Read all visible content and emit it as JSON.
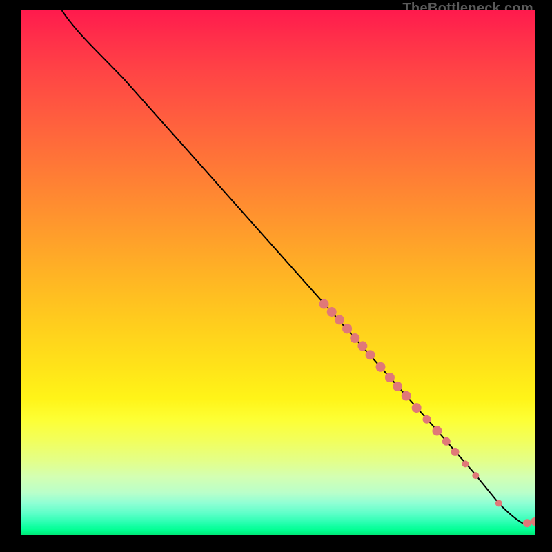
{
  "watermark": "TheBottleneck.com",
  "chart_data": {
    "type": "line",
    "title": "",
    "xlabel": "",
    "ylabel": "",
    "xlim": [
      0,
      100
    ],
    "ylim": [
      0,
      100
    ],
    "background_gradient": {
      "top": "#ff1a4d",
      "middle": "#ffe319",
      "bottom": "#00e878"
    },
    "curve": {
      "description": "Descending bottleneck curve from top-left to bottom-right",
      "points": [
        {
          "x": 8,
          "y": 100
        },
        {
          "x": 10,
          "y": 97
        },
        {
          "x": 14,
          "y": 93
        },
        {
          "x": 20,
          "y": 87
        },
        {
          "x": 30,
          "y": 76
        },
        {
          "x": 40,
          "y": 65
        },
        {
          "x": 50,
          "y": 54
        },
        {
          "x": 60,
          "y": 43
        },
        {
          "x": 70,
          "y": 32
        },
        {
          "x": 80,
          "y": 21
        },
        {
          "x": 88,
          "y": 12
        },
        {
          "x": 93,
          "y": 6
        },
        {
          "x": 96,
          "y": 3
        },
        {
          "x": 98,
          "y": 2
        },
        {
          "x": 100,
          "y": 2.5
        }
      ]
    },
    "highlighted_points": [
      {
        "x": 59,
        "y": 44,
        "r": 7
      },
      {
        "x": 60.5,
        "y": 42.5,
        "r": 7
      },
      {
        "x": 62,
        "y": 41,
        "r": 7
      },
      {
        "x": 63.5,
        "y": 39.3,
        "r": 7
      },
      {
        "x": 65,
        "y": 37.5,
        "r": 7
      },
      {
        "x": 66.5,
        "y": 36,
        "r": 7
      },
      {
        "x": 68,
        "y": 34.3,
        "r": 7
      },
      {
        "x": 70,
        "y": 32,
        "r": 7
      },
      {
        "x": 71.8,
        "y": 30,
        "r": 7
      },
      {
        "x": 73.3,
        "y": 28.3,
        "r": 7
      },
      {
        "x": 75,
        "y": 26.5,
        "r": 7
      },
      {
        "x": 77,
        "y": 24.2,
        "r": 7
      },
      {
        "x": 79,
        "y": 22,
        "r": 6
      },
      {
        "x": 81,
        "y": 19.8,
        "r": 7
      },
      {
        "x": 82.8,
        "y": 17.8,
        "r": 6
      },
      {
        "x": 84.5,
        "y": 15.8,
        "r": 6
      },
      {
        "x": 86.5,
        "y": 13.5,
        "r": 5
      },
      {
        "x": 88.5,
        "y": 11.3,
        "r": 5
      },
      {
        "x": 93,
        "y": 6,
        "r": 5
      },
      {
        "x": 98.5,
        "y": 2.2,
        "r": 6
      },
      {
        "x": 100,
        "y": 2.5,
        "r": 6
      }
    ],
    "point_color": "#e07878"
  }
}
